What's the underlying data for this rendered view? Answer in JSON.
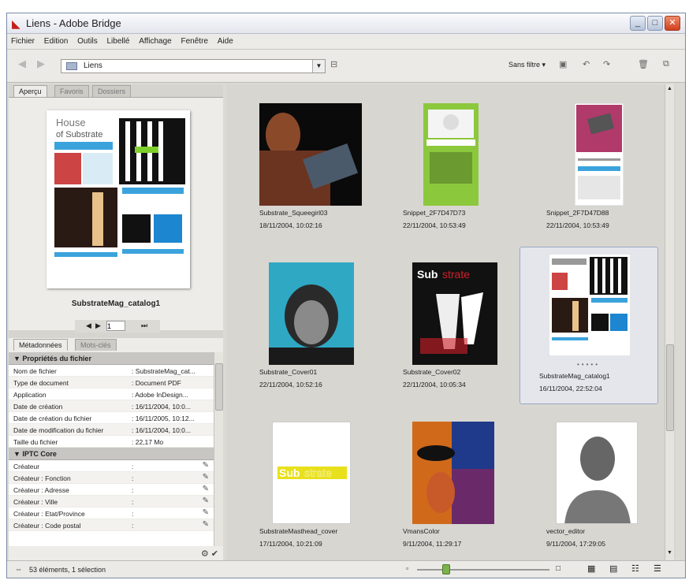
{
  "window": {
    "title": "Liens - Adobe Bridge"
  },
  "menu": [
    "Fichier",
    "Edition",
    "Outils",
    "Libellé",
    "Affichage",
    "Fenêtre",
    "Aide"
  ],
  "toolbar": {
    "path": "Liens",
    "filter_label": "Sans filtre ▾"
  },
  "left_panel": {
    "tabs": [
      "Aperçu",
      "Favoris",
      "Dossiers"
    ],
    "preview_name": "SubstrateMag_catalog1",
    "page_number": "1",
    "meta_tabs": [
      "Métadonnées",
      "Mots-clés"
    ],
    "sections": [
      {
        "title": "Propriétés du fichier",
        "rows": [
          {
            "k": "Nom de fichier",
            "v": ": SubstrateMag_cat..."
          },
          {
            "k": "Type de document",
            "v": ": Document PDF"
          },
          {
            "k": "Application",
            "v": ": Adobe InDesign..."
          },
          {
            "k": "Date de création",
            "v": ": 16/11/2004, 10:0..."
          },
          {
            "k": "Date de création du fichier",
            "v": ": 16/11/2005, 10:12..."
          },
          {
            "k": "Date de modification du fichier",
            "v": ": 16/11/2004, 10:0..."
          },
          {
            "k": "Taille du fichier",
            "v": ": 22,17 Mo"
          }
        ]
      },
      {
        "title": "IPTC Core",
        "rows": [
          {
            "k": "Créateur",
            "v": ":"
          },
          {
            "k": "Créateur : Fonction",
            "v": ":"
          },
          {
            "k": "Créateur : Adresse",
            "v": ":"
          },
          {
            "k": "Créateur : Ville",
            "v": ":"
          },
          {
            "k": "Créateur : Etat/Province",
            "v": ":"
          },
          {
            "k": "Créateur : Code postal",
            "v": ":"
          }
        ]
      }
    ]
  },
  "thumbnails": [
    {
      "name": "Substrate_Squeegirl03",
      "date": "18/11/2004, 10:02:16"
    },
    {
      "name": "Snippet_2F7D47D73",
      "date": "22/11/2004, 10:53:49"
    },
    {
      "name": "Snippet_2F7D47D88",
      "date": "22/11/2004, 10:53:49"
    },
    {
      "name": "Substrate_Cover01",
      "date": "22/11/2004, 10:52:16"
    },
    {
      "name": "Substrate_Cover02",
      "date": "22/11/2004, 10:05:34"
    },
    {
      "name": "SubstrateMag_catalog1",
      "date": "16/11/2004, 22:52:04"
    },
    {
      "name": "SubstrateMasthead_cover",
      "date": "17/11/2004, 10:21:09"
    },
    {
      "name": "VmansColor",
      "date": "9/11/2004, 11:29:17"
    },
    {
      "name": "vector_editor",
      "date": "9/11/2004, 17:29:05"
    }
  ],
  "status": {
    "text": "53 éléments, 1 sélection"
  },
  "colors": {
    "accent": "#7bb24c",
    "selection": "#98a8c4"
  }
}
